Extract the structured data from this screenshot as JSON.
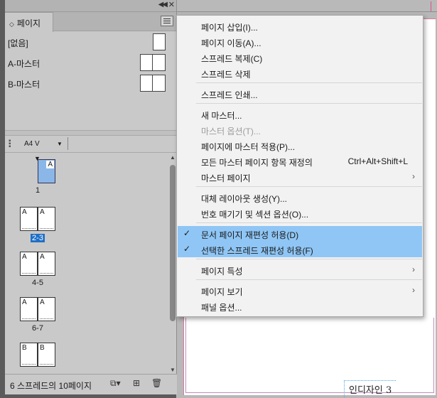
{
  "canvas": {
    "footer_text": "인디자인 3"
  },
  "panel": {
    "tab_label": "페이지",
    "masters": [
      {
        "label": "[없음]",
        "pages": 1
      },
      {
        "label": "A-마스터",
        "pages": 2
      },
      {
        "label": "B-마스터",
        "pages": 2
      }
    ],
    "page_size": "A4 V",
    "spreads": [
      {
        "left": "",
        "right": "A",
        "label": "1",
        "selected_page": true,
        "single": true
      },
      {
        "left": "A",
        "right": "A",
        "label": "2-3",
        "selected_label": true
      },
      {
        "left": "A",
        "right": "A",
        "label": "4-5"
      },
      {
        "left": "A",
        "right": "A",
        "label": "6-7"
      },
      {
        "left": "B",
        "right": "B",
        "label": ""
      }
    ],
    "status": "6 스프레드의 10페이지"
  },
  "menu": {
    "groups": [
      [
        {
          "label": "페이지 삽입(I)..."
        },
        {
          "label": "페이지 이동(A)..."
        },
        {
          "label": "스프레드 복제(C)"
        },
        {
          "label": "스프레드 삭제"
        }
      ],
      [
        {
          "label": "스프레드 인쇄..."
        }
      ],
      [
        {
          "label": "새 마스터..."
        },
        {
          "label": "마스터 옵션(T)...",
          "disabled": true
        },
        {
          "label": "페이지에 마스터 적용(P)..."
        },
        {
          "label": "모든 마스터 페이지 항목 재정의",
          "shortcut": "Ctrl+Alt+Shift+L"
        },
        {
          "label": "마스터 페이지",
          "submenu": true
        }
      ],
      [
        {
          "label": "대체 레이아웃 생성(Y)..."
        },
        {
          "label": "번호 매기기 및 섹션 옵션(O)..."
        }
      ],
      [
        {
          "label": "문서 페이지 재편성 허용(D)",
          "checked": true
        },
        {
          "label": "선택한 스프레드 재편성 허용(F)",
          "checked": true
        }
      ],
      [
        {
          "label": "페이지 특성",
          "submenu": true
        }
      ],
      [
        {
          "label": "페이지 보기",
          "submenu": true
        },
        {
          "label": "패널 옵션..."
        }
      ]
    ]
  }
}
